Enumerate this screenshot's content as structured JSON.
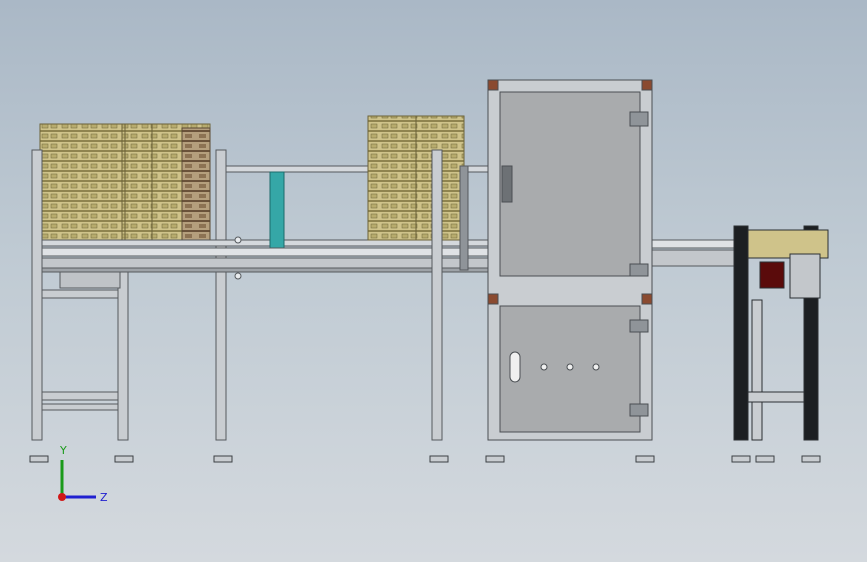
{
  "view": {
    "background_top": "#aab8c6",
    "background_bottom": "#d4d9de"
  },
  "triad": {
    "y_label": "Y",
    "z_label": "Z",
    "y_color": "#1a9a1a",
    "z_color": "#2020d0",
    "x_color": "#d01818"
  },
  "model": {
    "frame_color": "#c9cdd1",
    "tray_color": "#cfc38a",
    "cabinet_color": "#a9abad",
    "corner_color": "#8a4a30",
    "slot_color": "#35a7a7",
    "motor_color": "#5a0b0b"
  }
}
